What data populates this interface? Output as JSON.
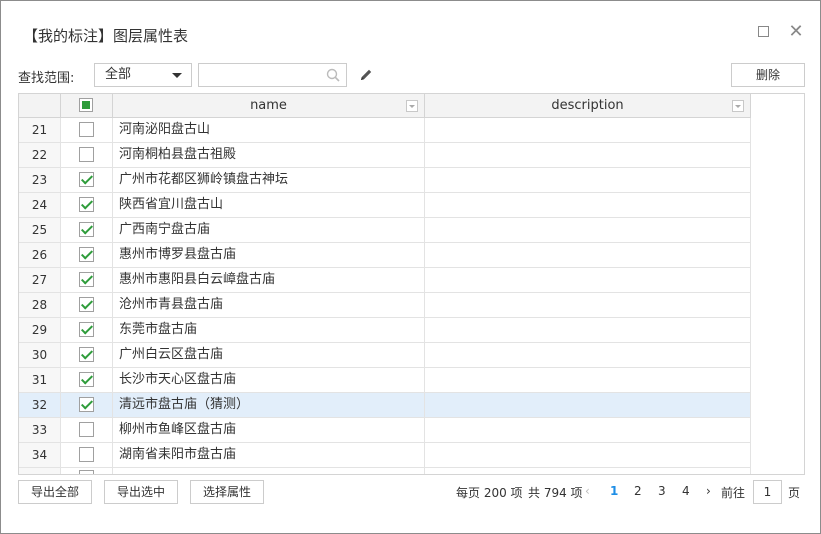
{
  "dialog": {
    "title": "【我的标注】图层属性表",
    "maximize_glyph": "",
    "close_glyph": "✕"
  },
  "toolbar": {
    "scope_label": "查找范围:",
    "scope_value": "全部",
    "search_value": "",
    "search_placeholder": "",
    "delete_label": "删除"
  },
  "table": {
    "columns": [
      "name",
      "description"
    ],
    "rows": [
      {
        "num": "21",
        "checked": false,
        "name": "河南泌阳盘古山",
        "description": ""
      },
      {
        "num": "22",
        "checked": false,
        "name": "河南桐柏县盘古祖殿",
        "description": ""
      },
      {
        "num": "23",
        "checked": true,
        "name": "广州市花都区狮岭镇盘古神坛",
        "description": ""
      },
      {
        "num": "24",
        "checked": true,
        "name": "陕西省宜川盘古山",
        "description": ""
      },
      {
        "num": "25",
        "checked": true,
        "name": "广西南宁盘古庙",
        "description": ""
      },
      {
        "num": "26",
        "checked": true,
        "name": "惠州市博罗县盘古庙",
        "description": ""
      },
      {
        "num": "27",
        "checked": true,
        "name": "惠州市惠阳县白云嶂盘古庙",
        "description": ""
      },
      {
        "num": "28",
        "checked": true,
        "name": "沧州市青县盘古庙",
        "description": ""
      },
      {
        "num": "29",
        "checked": true,
        "name": "东莞市盘古庙",
        "description": ""
      },
      {
        "num": "30",
        "checked": true,
        "name": "广州白云区盘古庙",
        "description": ""
      },
      {
        "num": "31",
        "checked": true,
        "name": "长沙市天心区盘古庙",
        "description": ""
      },
      {
        "num": "32",
        "checked": true,
        "name": "清远市盘古庙（猜测）",
        "description": "",
        "selected": true
      },
      {
        "num": "33",
        "checked": false,
        "name": "柳州市鱼峰区盘古庙",
        "description": ""
      },
      {
        "num": "34",
        "checked": false,
        "name": "湖南省耒阳市盘古庙",
        "description": ""
      }
    ]
  },
  "footer": {
    "export_all_label": "导出全部",
    "export_selected_label": "导出选中",
    "select_attr_label": "选择属性"
  },
  "pagination": {
    "per_page_text": "每页 200 项",
    "total_text": "共 794 项",
    "prev_glyph": "‹",
    "pages": [
      "1",
      "2",
      "3",
      "4"
    ],
    "current_page": "1",
    "next_glyph": "›",
    "goto_label": "前往",
    "goto_value": "1",
    "page_unit": "页"
  },
  "colors": {
    "accent": "#1e8ee6",
    "check": "#2e9c3a",
    "selected_row": "#e2eefa"
  }
}
